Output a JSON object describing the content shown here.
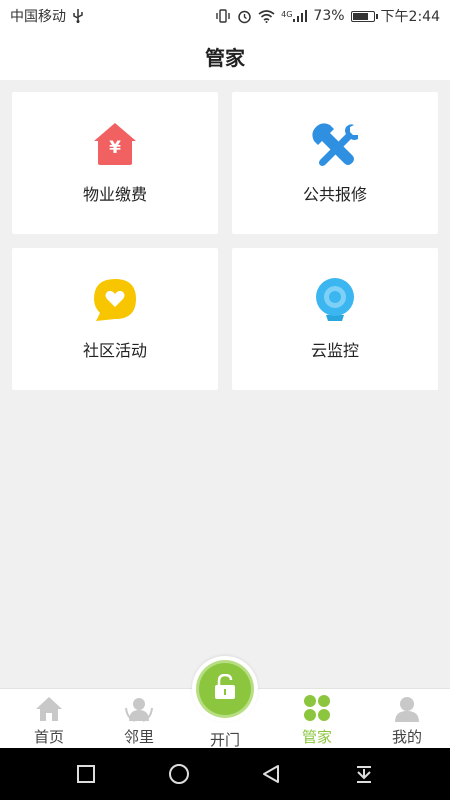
{
  "status_bar": {
    "carrier": "中国移动",
    "usb_icon": "usb-icon",
    "signal_type": "4G",
    "battery_percent": "73%",
    "battery_level": 0.73,
    "time": "下午2:44"
  },
  "header": {
    "title": "管家"
  },
  "grid": {
    "items": [
      {
        "label": "物业缴费",
        "icon": "house-yen-icon",
        "color": "#f26161"
      },
      {
        "label": "公共报修",
        "icon": "tools-icon",
        "color": "#2f8fe0"
      },
      {
        "label": "社区活动",
        "icon": "heart-bubble-icon",
        "color": "#f7c600"
      },
      {
        "label": "云监控",
        "icon": "webcam-icon",
        "color": "#3cb6f0"
      }
    ]
  },
  "tab_bar": {
    "tabs": [
      {
        "label": "首页",
        "icon": "home-icon"
      },
      {
        "label": "邻里",
        "icon": "neighbors-icon"
      },
      {
        "label": "开门",
        "icon": "unlock-icon"
      },
      {
        "label": "管家",
        "icon": "grid-icon",
        "active": true
      },
      {
        "label": "我的",
        "icon": "person-icon"
      }
    ],
    "active_color": "#8cc63f",
    "inactive_color": "#c8c8c8"
  },
  "nav_bar": {
    "buttons": [
      "recent-apps-icon",
      "home-circle-icon",
      "back-icon",
      "notification-pull-icon"
    ]
  }
}
